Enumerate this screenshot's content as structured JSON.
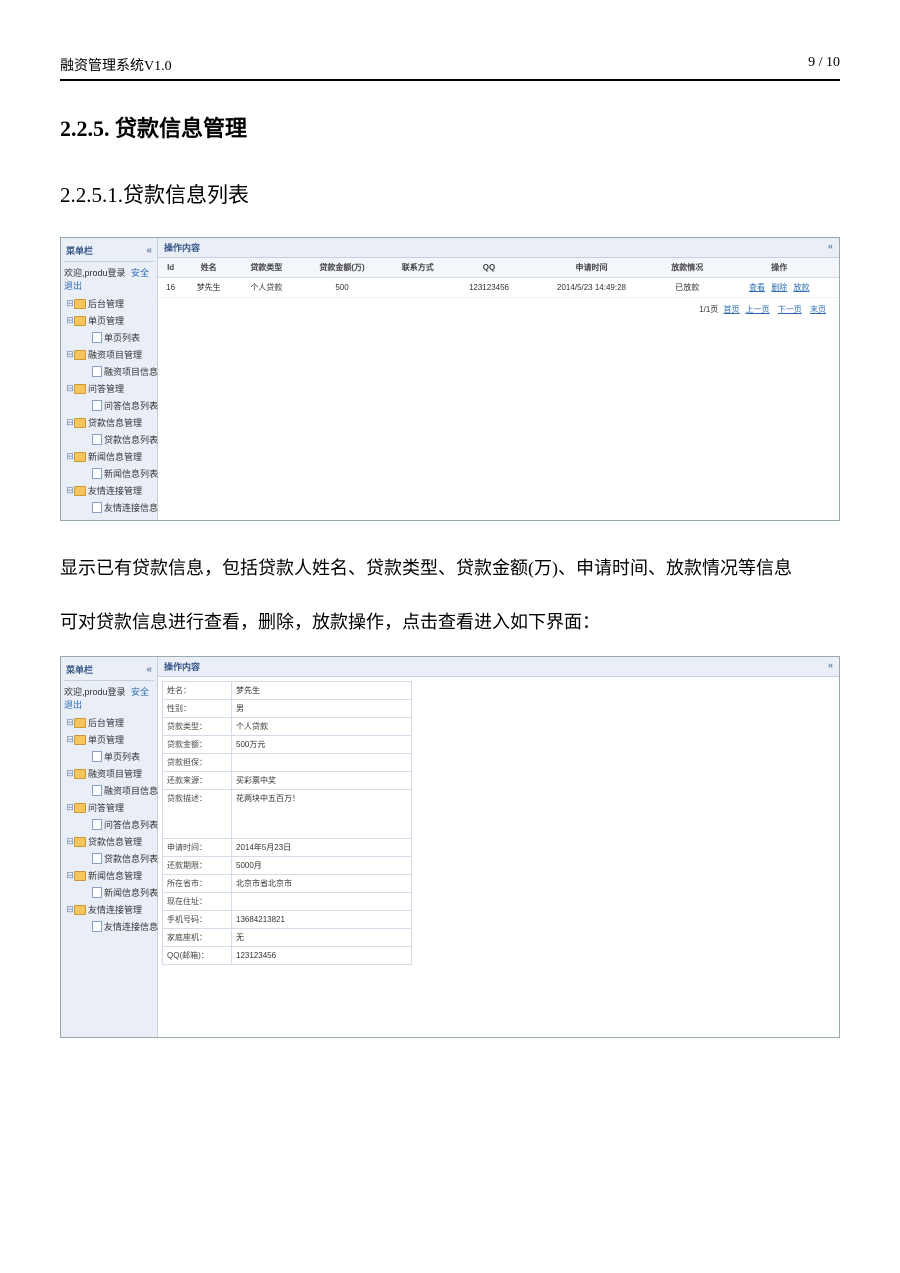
{
  "doc": {
    "title": "融资管理系统V1.0",
    "page": "9 / 10",
    "h2": "2.2.5. 贷款信息管理",
    "h3": "2.2.5.1.贷款信息列表",
    "para1": "显示已有贷款信息，包括贷款人姓名、贷款类型、贷款金额(万)、申请时间、放款情况等信息",
    "para2": "可对贷款信息进行查看，删除，放款操作，点击查看进入如下界面："
  },
  "side": {
    "title": "菜单栏",
    "welcome_pre": "欢迎,produ登录",
    "logout": "安全退出",
    "root": "后台管理",
    "nodes": [
      {
        "label": "单页管理",
        "children": [
          "单页列表"
        ]
      },
      {
        "label": "融资项目管理",
        "children": [
          "融资项目信息"
        ]
      },
      {
        "label": "问答管理",
        "children": [
          "问答信息列表"
        ]
      },
      {
        "label": "贷款信息管理",
        "children": [
          "贷款信息列表"
        ]
      },
      {
        "label": "新闻信息管理",
        "children": [
          "新闻信息列表"
        ]
      },
      {
        "label": "友情连接管理",
        "children": [
          "友情连接信息"
        ]
      }
    ]
  },
  "pane": {
    "title": "操作内容"
  },
  "table": {
    "headers": [
      "Id",
      "姓名",
      "贷款类型",
      "贷款金额(万)",
      "联系方式",
      "QQ",
      "申请时间",
      "放款情况",
      "操作"
    ],
    "row": {
      "id": "16",
      "name": "梦先生",
      "type": "个人贷款",
      "amount": "500",
      "phone": "",
      "qq": "123123456",
      "time": "2014/5/23 14:49:28",
      "status": "已放款",
      "a1": "查看",
      "a2": "删除",
      "a3": "放款"
    },
    "pager_text": "1/1页",
    "p1": "首页",
    "p2": "上一页",
    "p3": "下一页",
    "p4": "末页"
  },
  "detail": {
    "rows": [
      {
        "k": "姓名：",
        "v": "梦先生"
      },
      {
        "k": "性别：",
        "v": "男"
      },
      {
        "k": "贷款类型：",
        "v": "个人贷款"
      },
      {
        "k": "贷款金额：",
        "v": "500万元"
      },
      {
        "k": "贷款担保：",
        "v": ""
      },
      {
        "k": "还款来源：",
        "v": "买彩票中奖"
      },
      {
        "k": "贷款描述：",
        "v": "花两块中五百万！",
        "big": true
      },
      {
        "k": "申请时间：",
        "v": "2014年5月23日"
      },
      {
        "k": "还款期限：",
        "v": "5000月"
      },
      {
        "k": "所在省市：",
        "v": "北京市省北京市"
      },
      {
        "k": "现在住址：",
        "v": ""
      },
      {
        "k": "手机号码：",
        "v": "13684213821"
      },
      {
        "k": "家庭座机：",
        "v": "无"
      },
      {
        "k": "QQ(邮箱)：",
        "v": "123123456"
      }
    ]
  }
}
